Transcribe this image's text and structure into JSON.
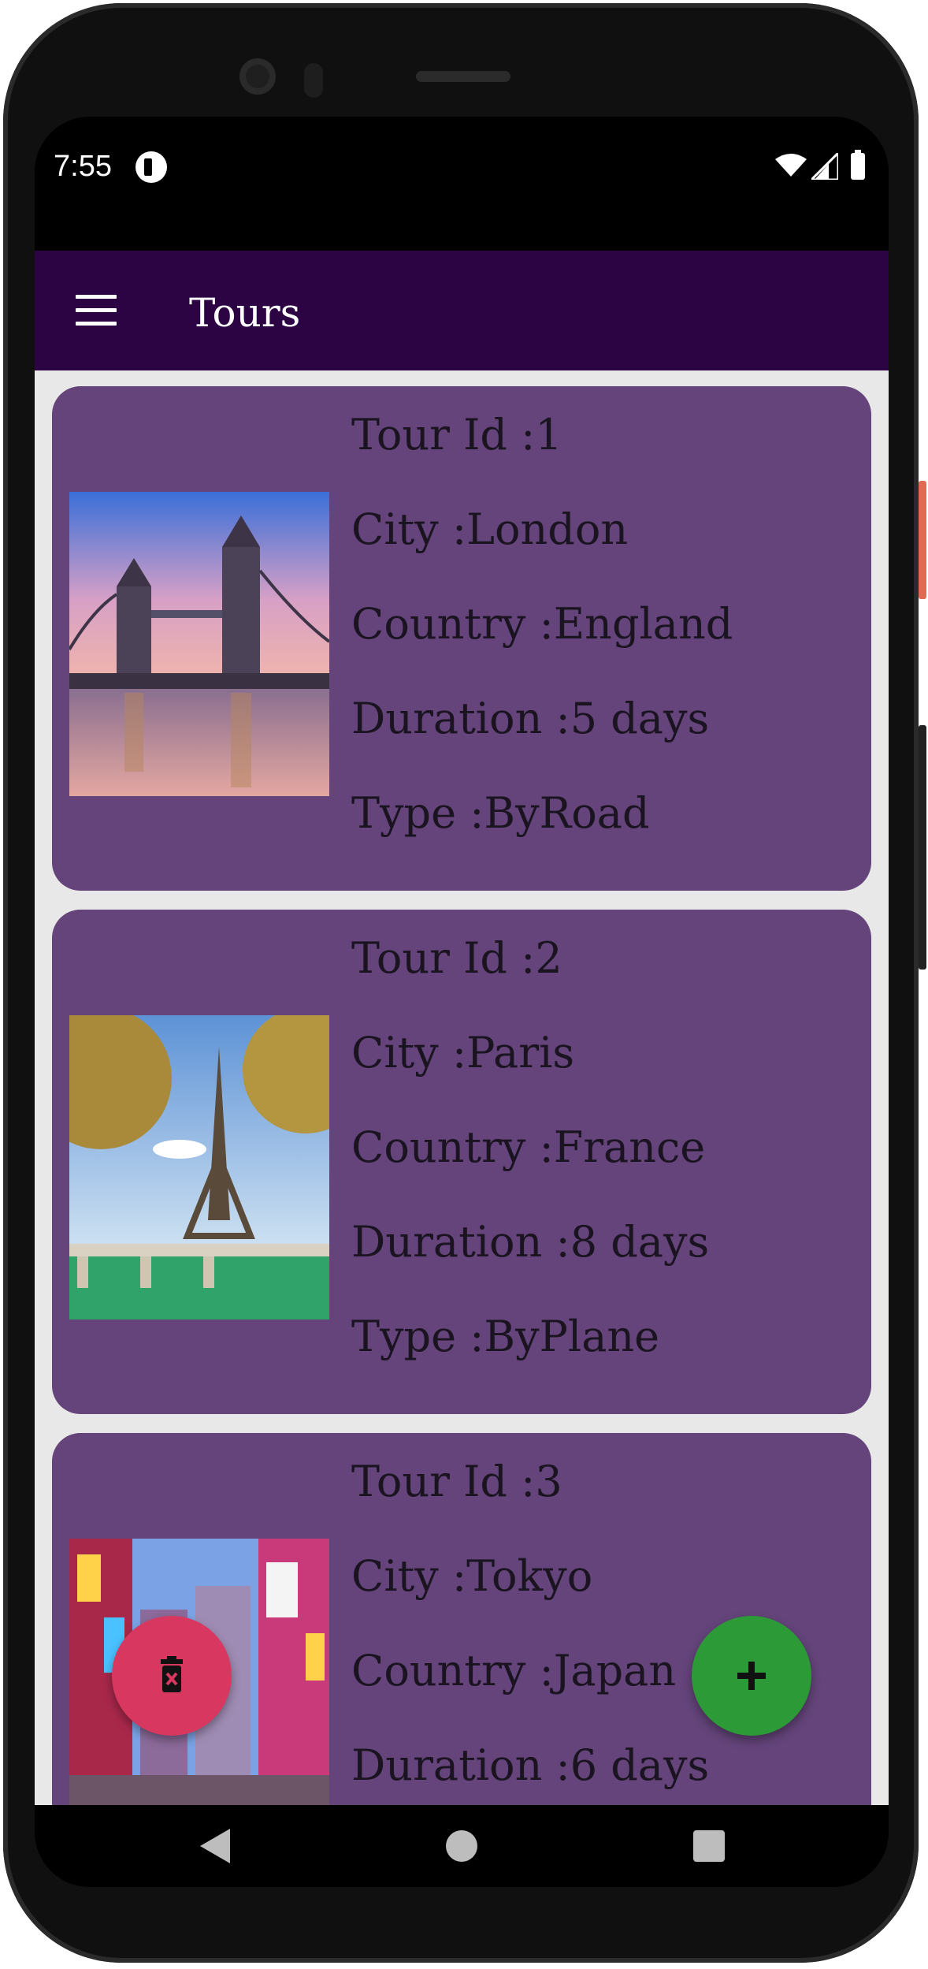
{
  "status_bar": {
    "time": "7:55"
  },
  "app_bar": {
    "title": "Tours"
  },
  "tours": [
    {
      "id_line": "Tour Id :1",
      "city_line": "City :London",
      "country_line": "Country :England",
      "duration_line": "Duration :5 days",
      "type_line": "Type :ByRoad",
      "image": "tower-bridge-photo"
    },
    {
      "id_line": "Tour Id :2",
      "city_line": "City :Paris",
      "country_line": "Country :France",
      "duration_line": "Duration :8 days",
      "type_line": "Type :ByPlane",
      "image": "eiffel-tower-photo"
    },
    {
      "id_line": "Tour Id :3",
      "city_line": "City :Tokyo",
      "country_line": "Country :Japan",
      "duration_line": "Duration :6 days",
      "image": "tokyo-street-photo"
    }
  ],
  "colors": {
    "app_bar": "#2c0444",
    "card": "#64447a",
    "background": "#e8e8e8",
    "fab_delete": "#d8385f",
    "fab_add": "#2c9a36"
  },
  "icons": [
    "menu-icon",
    "delete-icon",
    "add-icon",
    "back-icon",
    "home-icon",
    "recents-icon"
  ]
}
